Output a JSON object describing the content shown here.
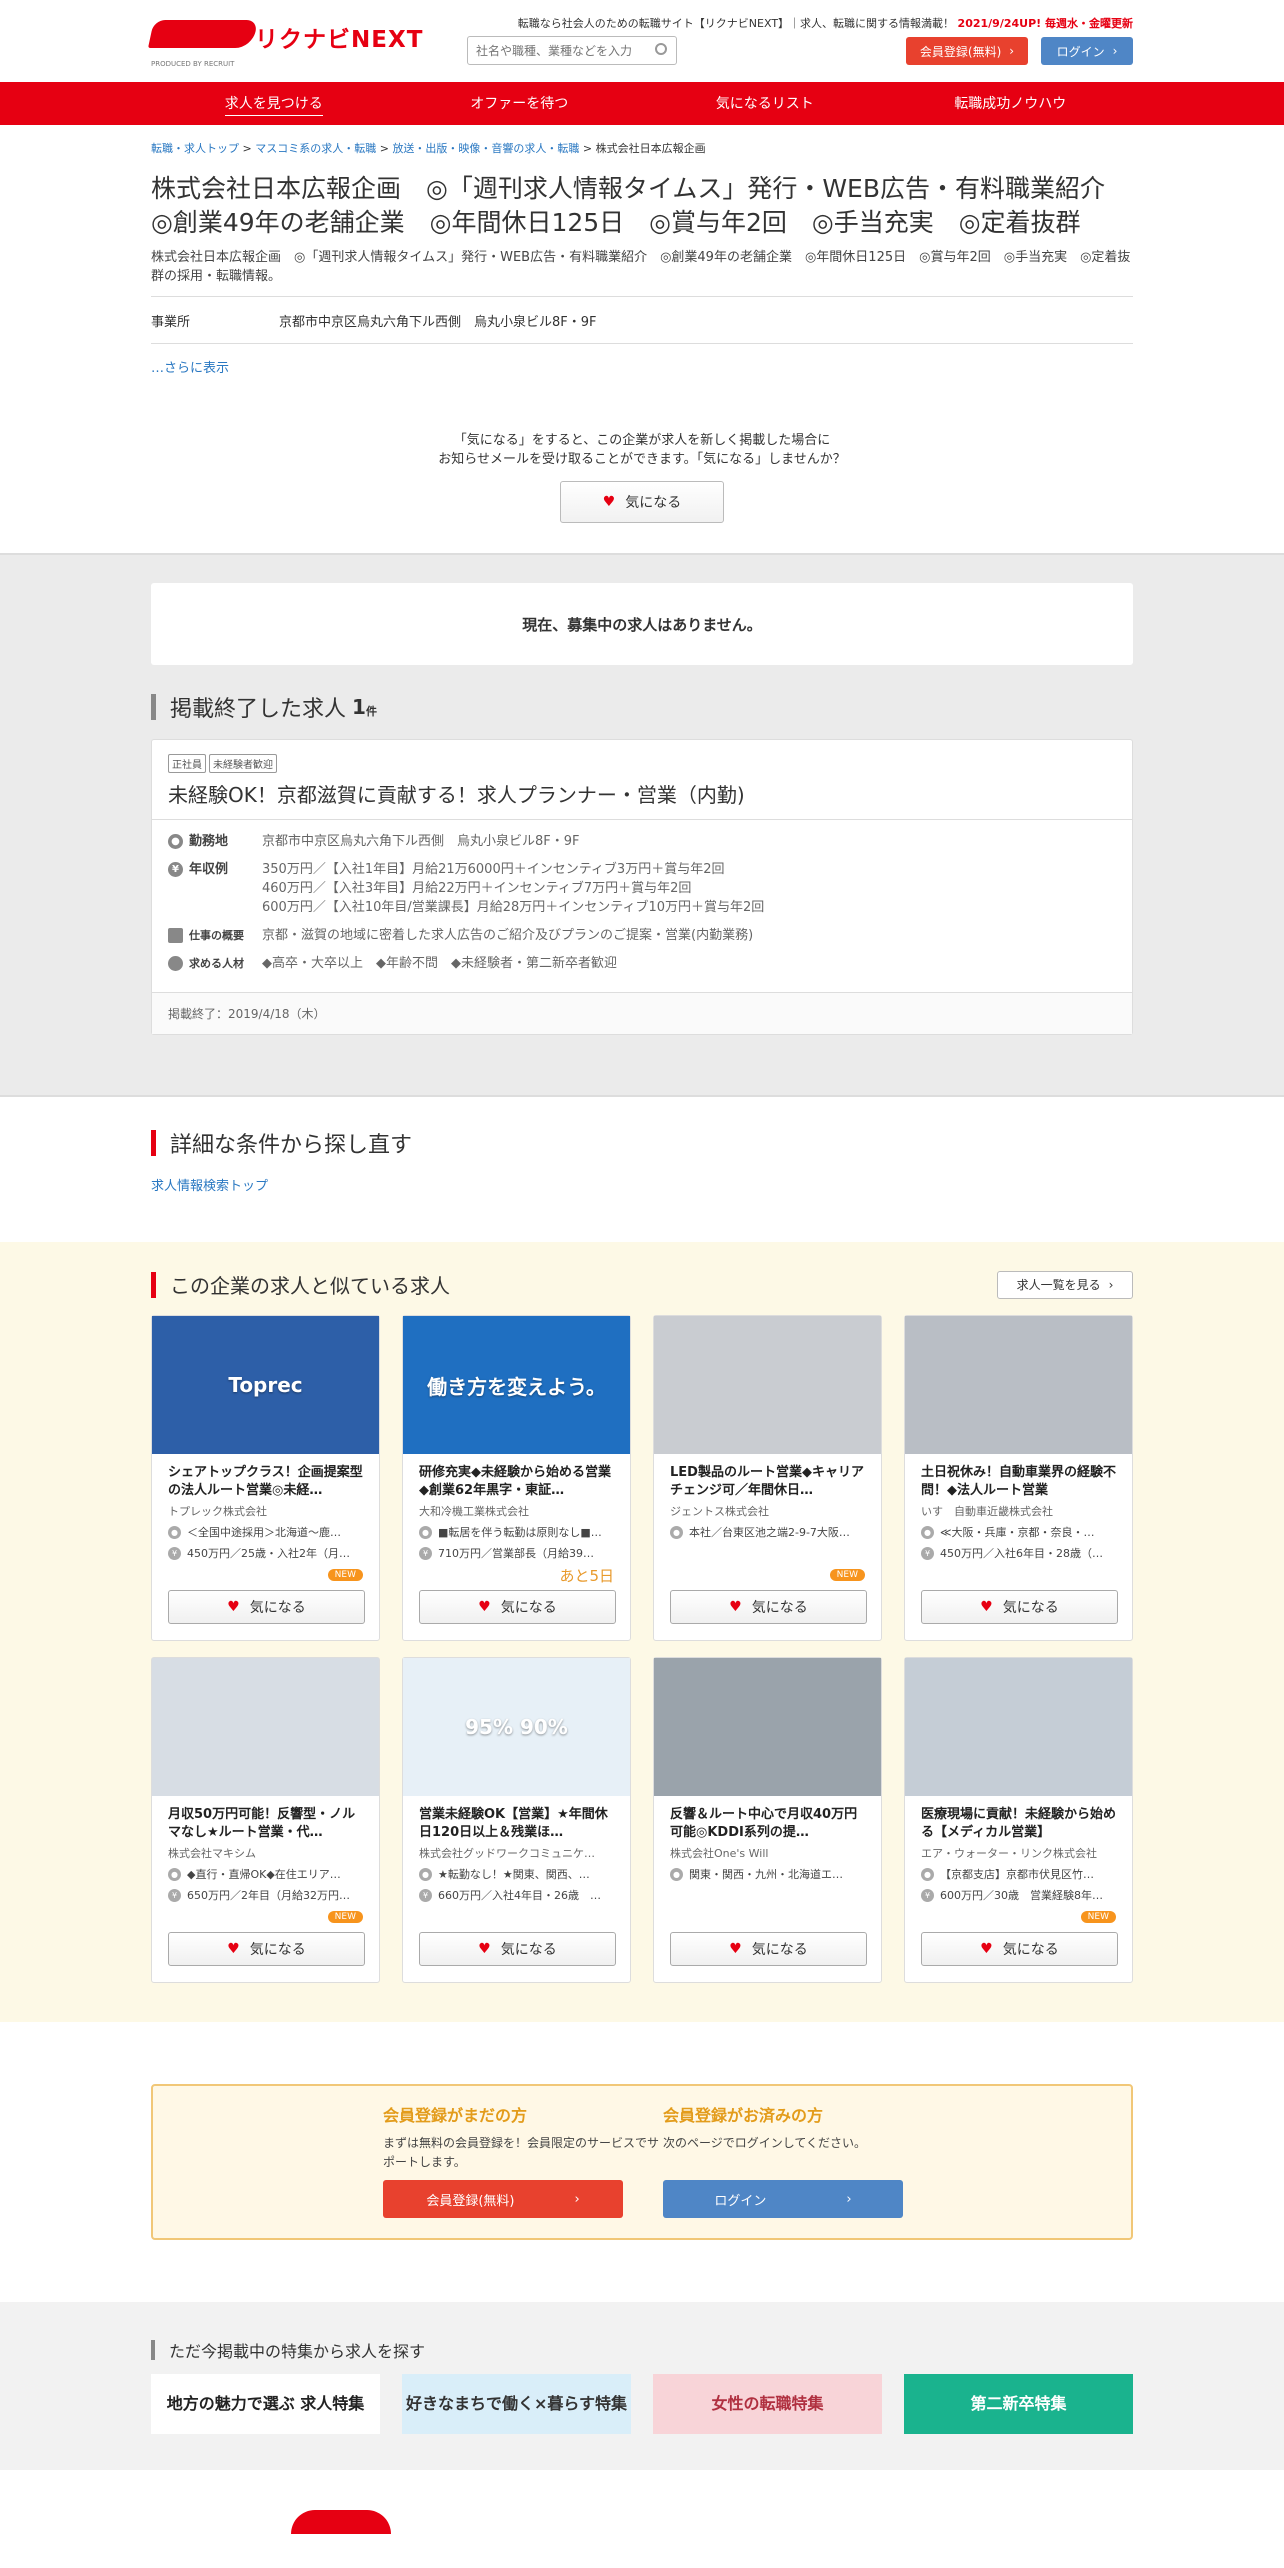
{
  "header": {
    "logo_text": "リクナビNEXT",
    "logo_sub": "PRODUCED BY RECRUIT",
    "tagline": "転職なら社会人のための転職サイト【リクナビNEXT】｜求人、転職に関する情報満載！",
    "update": "2021/9/24UP! 毎週水・金曜更新",
    "search_placeholder": "社名や職種、業種などを入力",
    "register_label": "会員登録(無料)",
    "login_label": "ログイン"
  },
  "nav": [
    {
      "label": "求人を見つける",
      "active": true
    },
    {
      "label": "オファーを待つ",
      "active": false
    },
    {
      "label": "気になるリスト",
      "active": false
    },
    {
      "label": "転職成功ノウハウ",
      "active": false
    }
  ],
  "breadcrumb": [
    "転職・求人トップ",
    "マスコミ系の求人・転職",
    "放送・出版・映像・音響の求人・転職",
    "株式会社日本広報企画"
  ],
  "company": {
    "title": "株式会社日本広報企画　◎「週刊求人情報タイムス」発行・WEB広告・有料職業紹介　◎創業49年の老舗企業　◎年間休日125日　◎賞与年2回　◎手当充実　◎定着抜群",
    "desc": "株式会社日本広報企画　◎「週刊求人情報タイムス」発行・WEB広告・有料職業紹介　◎創業49年の老舗企業　◎年間休日125日　◎賞与年2回　◎手当充実　◎定着抜群の採用・転職情報。",
    "office_label": "事業所",
    "office_value": "京都市中京区烏丸六角下ル西側　烏丸小泉ビル8F・9F",
    "more": "…さらに表示",
    "fav_msg1": "「気になる」をすると、この企業が求人を新しく掲載した場合に",
    "fav_msg2": "お知らせメールを受け取ることができます。「気になる」しませんか？",
    "fav_label": "気になる"
  },
  "no_jobs": "現在、募集中の求人はありません。",
  "ended": {
    "heading": "掲載終了した求人",
    "count": "1",
    "unit": "件",
    "tags": [
      "正社員",
      "未経験者歓迎"
    ],
    "title": "未経験OK！京都滋賀に貢献する！求人プランナー・営業（内勤)",
    "rows": [
      {
        "label": "勤務地",
        "value": "京都市中京区烏丸六角下ル西側　烏丸小泉ビル8F・9F"
      },
      {
        "label": "年収例",
        "value": "350万円／【入社1年目】月給21万6000円＋インセンティブ3万円＋賞与年2回\n460万円／【入社3年目】月給22万円＋インセンティブ7万円＋賞与年2回\n600万円／【入社10年目/営業課長】月給28万円＋インセンティブ10万円＋賞与年2回"
      },
      {
        "label": "仕事の概要",
        "value": "京都・滋賀の地域に密着した求人広告のご紹介及びプランのご提案・営業(内勤業務)"
      },
      {
        "label": "求める人材",
        "value": "◆高卒・大卒以上　◆年齢不問　◆未経験者・第二新卒者歓迎"
      }
    ],
    "footer": "掲載終了：2019/4/18（木）"
  },
  "search_again": {
    "heading": "詳細な条件から探し直す",
    "link": "求人情報検索トップ"
  },
  "similar": {
    "heading": "この企業の求人と似ている求人",
    "all_label": "求人一覧を見る",
    "fav_label": "気になる",
    "cards": [
      {
        "thumb": "Toprec",
        "title": "シェアトップクラス！企画提案型の法人ルート営業◎未経…",
        "company": "トプレック株式会社",
        "loc": "＜全国中途採用＞北海道～鹿…",
        "pay": "450万円／25歳・入社2年（月…",
        "badge": "NEW",
        "color": "#2d5fa8"
      },
      {
        "thumb": "働き方を変えよう。",
        "title": "研修充実◆未経験から始める営業◆創業62年黒字・東証…",
        "company": "大和冷機工業株式会社",
        "loc": "■転居を伴う転勤は原則なし■…",
        "pay": "710万円／営業部長（月給39…",
        "badge": "あと5日",
        "color": "#1f6fc1"
      },
      {
        "thumb": "",
        "title": "LED製品のルート営業◆キャリアチェンジ可／年間休日…",
        "company": "ジェントス株式会社",
        "loc": "本社／台東区池之端2-9-7大阪…",
        "pay": "",
        "badge": "NEW",
        "color": "#c9ccd1"
      },
      {
        "thumb": "",
        "title": "土日祝休み！自動車業界の経験不問！◆法人ルート営業",
        "company": "いす　自動車近畿株式会社",
        "loc": "≪大阪・兵庫・京都・奈良・…",
        "pay": "450万円／入社6年目・28歳（…",
        "badge": "",
        "color": "#b9bec5"
      },
      {
        "thumb": "",
        "title": "月収50万円可能！反響型・ノルマなし★ルート営業・代…",
        "company": "株式会社マキシム",
        "loc": "◆直行・直帰OK◆在住エリア…",
        "pay": "650万円／2年目（月給32万円…",
        "badge": "NEW",
        "color": "#d7dde4"
      },
      {
        "thumb": "95% 90%",
        "title": "営業未経験OK【営業】★年間休日120日以上＆残業ほ…",
        "company": "株式会社グッドワークコミュニケ…",
        "loc": "★転勤なし！★関東、関西、…",
        "pay": "660万円／入社4年目・26歳　…",
        "badge": "",
        "color": "#e7f0f7"
      },
      {
        "thumb": "",
        "title": "反響＆ルート中心で月収40万円可能◎KDDI系列の提…",
        "company": "株式会社One's Will",
        "loc": "関東・関西・九州・北海道エ…",
        "pay": "",
        "badge": "",
        "color": "#9aa3ab"
      },
      {
        "thumb": "",
        "title": "医療現場に貢献！未経験から始める【メディカル営業】",
        "company": "エア・ウォーター・リンク株式会社",
        "loc": "【京都支店】京都市伏見区竹…",
        "pay": "600万円／30歳　営業経験8年…",
        "badge": "NEW",
        "color": "#c5cdd6"
      }
    ]
  },
  "register": {
    "left_heading": "会員登録がまだの方",
    "left_text": "まずは無料の会員登録を！会員限定のサービスでサポートします。",
    "left_btn": "会員登録(無料)",
    "right_heading": "会員登録がお済みの方",
    "right_text": "次のページでログインしてください。",
    "right_btn": "ログイン"
  },
  "features": {
    "heading": "ただ今掲載中の特集から求人を探す",
    "banners": [
      {
        "label": "地方の魅力で選ぶ 求人特集",
        "bg": "#ffffff",
        "fg": "#222"
      },
      {
        "label": "好きなまちで働く×暮らす特集",
        "bg": "#d9eef9",
        "fg": "#333"
      },
      {
        "label": "女性の転職特集",
        "bg": "#f8d4d8",
        "fg": "#b03040"
      },
      {
        "label": "第二新卒特集",
        "bg": "#1ab38e",
        "fg": "#fff"
      }
    ]
  }
}
